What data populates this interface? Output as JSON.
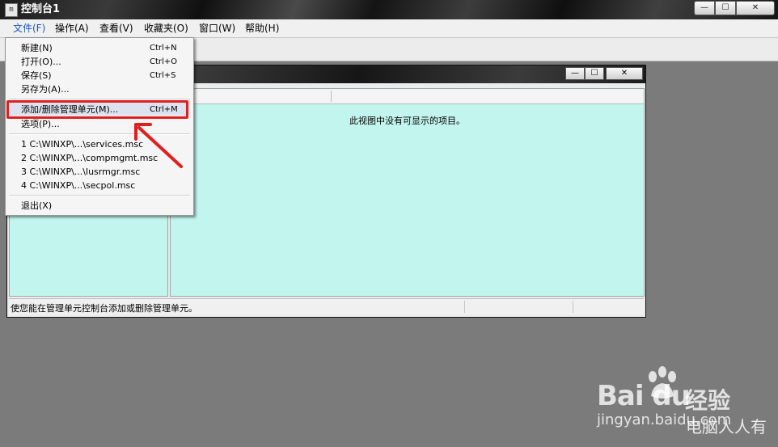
{
  "window": {
    "title": "控制台1",
    "icon": "console-icon",
    "icon_glyph": "m",
    "min_glyph": "—",
    "max_glyph": "☐",
    "close_glyph": "✕"
  },
  "menubar": {
    "items": [
      {
        "label": "文件(F)"
      },
      {
        "label": "操作(A)"
      },
      {
        "label": "查看(V)"
      },
      {
        "label": "收藏夹(O)"
      },
      {
        "label": "窗口(W)"
      },
      {
        "label": "帮助(H)"
      }
    ]
  },
  "file_menu": {
    "items": [
      {
        "label": "新建(N)",
        "shortcut": "Ctrl+N"
      },
      {
        "label": "打开(O)...",
        "shortcut": "Ctrl+O"
      },
      {
        "label": "保存(S)",
        "shortcut": "Ctrl+S"
      },
      {
        "label": "另存为(A)...",
        "shortcut": ""
      },
      {
        "label": "添加/删除管理单元(M)...",
        "shortcut": "Ctrl+M"
      },
      {
        "label": "选项(P)...",
        "shortcut": ""
      },
      {
        "label": "1 C:\\WINXP\\...\\services.msc",
        "shortcut": ""
      },
      {
        "label": "2 C:\\WINXP\\...\\compmgmt.msc",
        "shortcut": ""
      },
      {
        "label": "3 C:\\WINXP\\...\\lusrmgr.msc",
        "shortcut": ""
      },
      {
        "label": "4 C:\\WINXP\\...\\secpol.msc",
        "shortcut": ""
      },
      {
        "label": "退出(X)",
        "shortcut": ""
      }
    ]
  },
  "child_window": {
    "empty_message": "此视图中没有可显示的项目。",
    "status_text": "使您能在管理单元控制台添加或删除管理单元。"
  },
  "watermark": {
    "logo": "Bai du",
    "brand_cn": "经验",
    "url": "jingyan.baidu.com",
    "author": "电脑人人有"
  },
  "colors": {
    "pane_background": "#c2f5ee",
    "highlight_box": "#e01f1f"
  }
}
